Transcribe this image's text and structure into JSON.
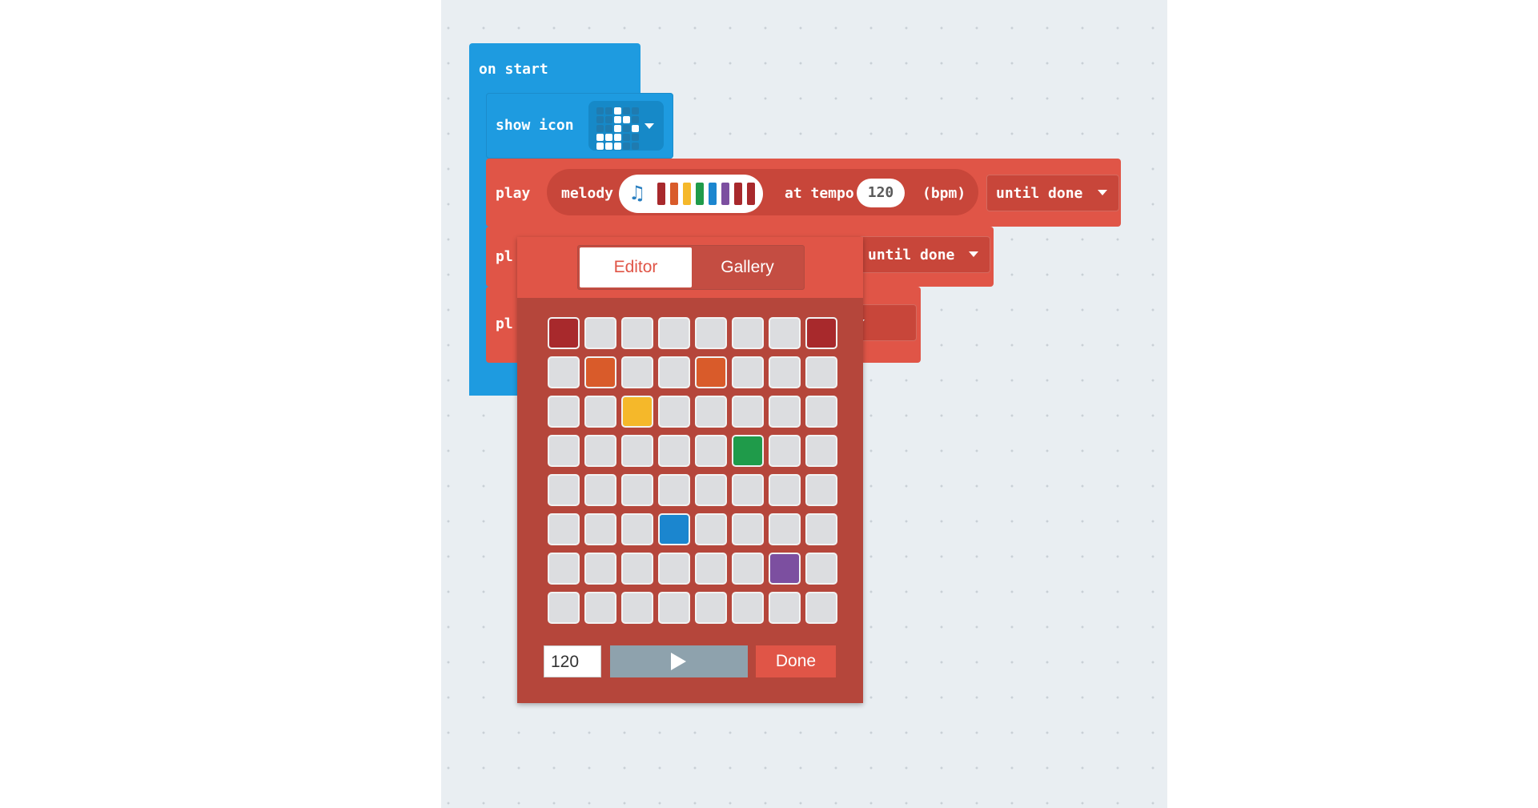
{
  "blocks": {
    "on_start": "on start",
    "show_icon": "show icon",
    "icon_leds": [
      0,
      0,
      1,
      0,
      0,
      0,
      0,
      1,
      1,
      0,
      0,
      0,
      1,
      0,
      1,
      1,
      1,
      1,
      0,
      0,
      1,
      1,
      1,
      0,
      0
    ],
    "play_rows": [
      {
        "play": "play",
        "melody": "melody",
        "at_tempo": "at tempo",
        "tempo": "120",
        "bpm": "(bpm)",
        "until": "until done"
      },
      {
        "play": "pl",
        "until": "until done"
      },
      {
        "play": "pl",
        "until": "ne"
      }
    ],
    "melody_colors": [
      "#a8292c",
      "#d95b2a",
      "#f5b82a",
      "#1f9b4a",
      "#1b86cf",
      "#7c4fa0",
      "#a8292c"
    ]
  },
  "melody_editor": {
    "tabs": [
      {
        "label": "Editor",
        "active": true
      },
      {
        "label": "Gallery",
        "active": false
      }
    ],
    "tempo_value": "120",
    "done_label": "Done",
    "grid_rows": 8,
    "grid_cols": 8,
    "selected_notes": [
      {
        "col": 0,
        "row": 0,
        "color": "#a8292c"
      },
      {
        "col": 1,
        "row": 1,
        "color": "#d95b2a"
      },
      {
        "col": 2,
        "row": 2,
        "color": "#f5b82a"
      },
      {
        "col": 3,
        "row": 5,
        "color": "#1b86cf"
      },
      {
        "col": 4,
        "row": 1,
        "color": "#d95b2a"
      },
      {
        "col": 5,
        "row": 3,
        "color": "#1f9b4a"
      },
      {
        "col": 6,
        "row": 6,
        "color": "#7c4fa0"
      },
      {
        "col": 7,
        "row": 0,
        "color": "#a8292c"
      }
    ]
  },
  "colors": {
    "workspace_bg": "#e9eef2",
    "basic_blue": "#1e9be0",
    "music_red": "#e05547"
  }
}
